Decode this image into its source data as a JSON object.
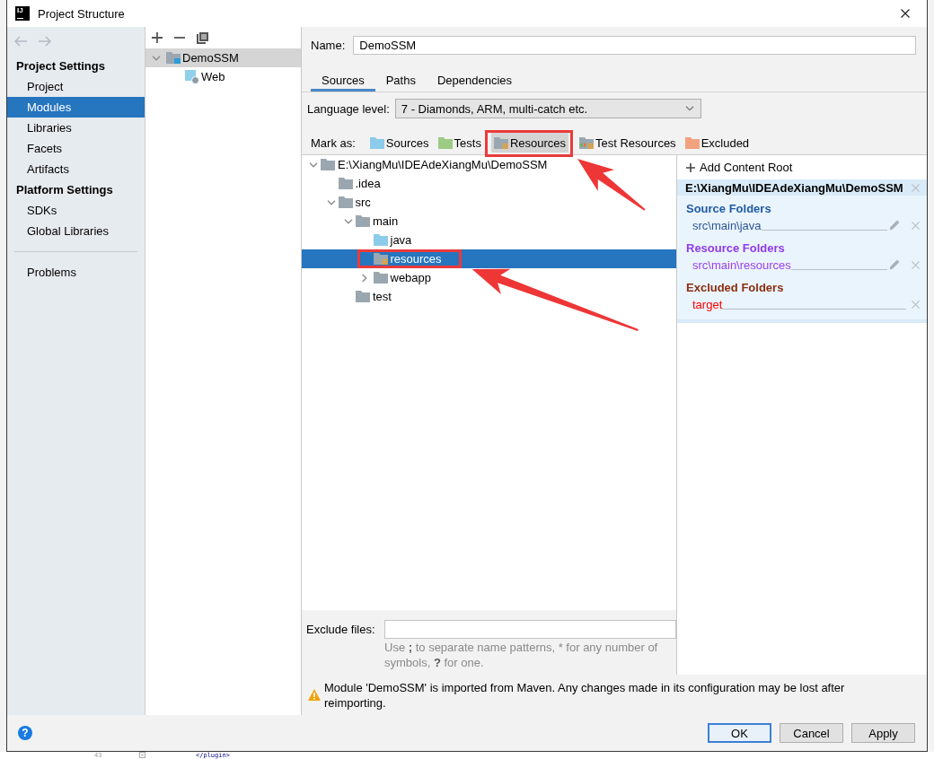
{
  "window": {
    "title": "Project Structure",
    "logo": "IJ"
  },
  "sidebar": {
    "nav": [
      {
        "kind": "back",
        "disabled": true
      },
      {
        "kind": "forward",
        "disabled": true
      }
    ],
    "sections": [
      {
        "title": "Project Settings",
        "items": [
          {
            "label": "Project",
            "selected": false
          },
          {
            "label": "Modules",
            "selected": true
          },
          {
            "label": "Libraries",
            "selected": false
          },
          {
            "label": "Facets",
            "selected": false
          },
          {
            "label": "Artifacts",
            "selected": false
          }
        ]
      },
      {
        "title": "Platform Settings",
        "items": [
          {
            "label": "SDKs",
            "selected": false
          },
          {
            "label": "Global Libraries",
            "selected": false
          }
        ]
      },
      {
        "items": [
          {
            "label": "Problems",
            "selected": false
          }
        ]
      }
    ]
  },
  "modules": {
    "toolbar": [
      {
        "kind": "add"
      },
      {
        "kind": "remove"
      },
      {
        "kind": "copy"
      }
    ],
    "tree": [
      {
        "label": "DemoSSM",
        "kind": "module",
        "expanded": true,
        "selected": true,
        "children": [
          {
            "label": "Web",
            "kind": "web",
            "selected": false
          }
        ]
      }
    ]
  },
  "name": {
    "label": "Name:",
    "value": "DemoSSM"
  },
  "tabs": [
    {
      "label": "Sources",
      "selected": true
    },
    {
      "label": "Paths",
      "selected": false
    },
    {
      "label": "Dependencies",
      "selected": false
    }
  ],
  "language_level": {
    "label": "Language level:",
    "value": "7 - Diamonds, ARM, multi-catch etc."
  },
  "mark_as": {
    "label": "Mark as:",
    "buttons": [
      {
        "label": "Sources",
        "kind": "sources",
        "selected": false,
        "callout": false
      },
      {
        "label": "Tests",
        "kind": "tests",
        "selected": false,
        "callout": false
      },
      {
        "label": "Resources",
        "kind": "resources",
        "selected": true,
        "callout": true
      },
      {
        "label": "Test Resources",
        "kind": "test_resources",
        "selected": false,
        "callout": false
      },
      {
        "label": "Excluded",
        "kind": "excluded",
        "selected": false,
        "callout": false
      }
    ]
  },
  "file_tree": [
    {
      "label": "E:\\XiangMu\\IDEAdeXiangMu\\DemoSSM",
      "kind": "folder",
      "expanded": true,
      "selected": false,
      "callout": false,
      "children": [
        {
          "label": ".idea",
          "kind": "folder",
          "selected": false,
          "callout": false
        },
        {
          "label": "src",
          "kind": "folder",
          "expanded": true,
          "selected": false,
          "callout": false,
          "children": [
            {
              "label": "main",
              "kind": "folder",
              "expanded": true,
              "selected": false,
              "callout": false,
              "children": [
                {
                  "label": "java",
                  "kind": "sources",
                  "selected": false,
                  "callout": false
                },
                {
                  "label": "resources",
                  "kind": "resources",
                  "selected": true,
                  "callout": true
                },
                {
                  "label": "webapp",
                  "kind": "folder",
                  "expanded": false,
                  "selected": false,
                  "callout": false
                }
              ]
            },
            {
              "label": "test",
              "kind": "folder",
              "selected": false,
              "callout": false
            }
          ]
        }
      ]
    }
  ],
  "content_root": {
    "add_label": "Add Content Root",
    "path": "E:\\XiangMu\\IDEAdeXiangMu\\DemoSSM",
    "groups": [
      {
        "kind": "sources",
        "title": "Source Folders",
        "folders": [
          {
            "path": "src\\main\\java",
            "editable": true
          }
        ]
      },
      {
        "kind": "resources",
        "title": "Resource Folders",
        "folders": [
          {
            "path": "src\\main\\resources",
            "editable": true
          }
        ]
      },
      {
        "kind": "excluded",
        "title": "Excluded Folders",
        "folders": [
          {
            "path": "target",
            "editable": false
          }
        ]
      }
    ]
  },
  "exclude_files": {
    "label": "Exclude files:",
    "hint": [
      {
        "text": "Use ",
        "bold": false
      },
      {
        "text": ";",
        "bold": true
      },
      {
        "text": " to separate name patterns, * for any number of symbols, ",
        "bold": false
      },
      {
        "text": "?",
        "bold": true
      },
      {
        "text": " for one.",
        "bold": false
      }
    ]
  },
  "warning": {
    "text": "Module 'DemoSSM' is imported from Maven. Any changes made in its configuration may be lost after reimporting."
  },
  "help": {
    "glyph": "?"
  },
  "buttons": [
    {
      "label": "OK",
      "default": true
    },
    {
      "label": "Cancel",
      "default": false
    },
    {
      "label": "Apply",
      "default": false
    }
  ],
  "background_editor": {
    "line_number": "43",
    "code": "</plugin>"
  }
}
